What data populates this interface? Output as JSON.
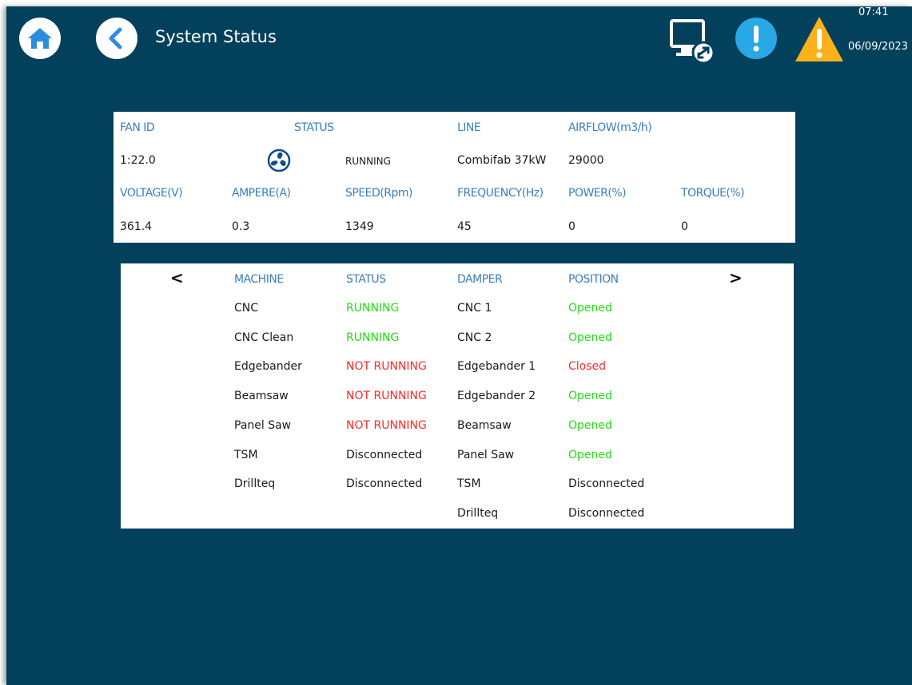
{
  "header": {
    "title": "System Status",
    "time": "07:41",
    "date": "06/09/2023",
    "icons": [
      "home-icon",
      "back-icon",
      "remote-desktop-icon",
      "info-icon",
      "warning-icon"
    ]
  },
  "fan": {
    "headers": {
      "fan_id": "FAN ID",
      "status": "STATUS",
      "line": "LINE",
      "airflow": "AIRFLOW(m3/h)",
      "voltage": "VOLTAGE(V)",
      "ampere": "AMPERE(A)",
      "speed": "SPEED(Rpm)",
      "frequency": "FREQUENCY(Hz)",
      "power": "POWER(%)",
      "torque": "TORQUE(%)"
    },
    "values": {
      "fan_id": "1:22.0",
      "status": "RUNNING",
      "line": "Combifab 37kW",
      "airflow": "29000",
      "voltage": "361.4",
      "ampere": "0.3",
      "speed": "1349",
      "frequency": "45",
      "power": "0",
      "torque": "0"
    }
  },
  "machines": {
    "nav_prev": "<",
    "nav_next": ">",
    "headers": {
      "machine": "MACHINE",
      "status": "STATUS",
      "damper": "DAMPER",
      "position": "POSITION"
    },
    "machine_rows": [
      {
        "name": "CNC",
        "status": "RUNNING",
        "state": "running"
      },
      {
        "name": "CNC Clean",
        "status": "RUNNING",
        "state": "running"
      },
      {
        "name": "Edgebander",
        "status": "NOT RUNNING",
        "state": "stopped"
      },
      {
        "name": "Beamsaw",
        "status": "NOT RUNNING",
        "state": "stopped"
      },
      {
        "name": "Panel Saw",
        "status": "NOT RUNNING",
        "state": "stopped"
      },
      {
        "name": "TSM",
        "status": "Disconnected",
        "state": "disconnected"
      },
      {
        "name": "Drillteq",
        "status": "Disconnected",
        "state": "disconnected"
      }
    ],
    "damper_rows": [
      {
        "name": "CNC 1",
        "position": "Opened",
        "state": "opened"
      },
      {
        "name": "CNC 2",
        "position": "Opened",
        "state": "opened"
      },
      {
        "name": "Edgebander 1",
        "position": "Closed",
        "state": "closed"
      },
      {
        "name": "Edgebander 2",
        "position": "Opened",
        "state": "opened"
      },
      {
        "name": "Beamsaw",
        "position": "Opened",
        "state": "opened"
      },
      {
        "name": "Panel Saw",
        "position": "Opened",
        "state": "opened"
      },
      {
        "name": "TSM",
        "position": "Disconnected",
        "state": "disconnected"
      },
      {
        "name": "Drillteq",
        "position": "Disconnected",
        "state": "disconnected"
      }
    ]
  },
  "colors": {
    "background": "#02405c",
    "header_text": "#3b7fba",
    "running": "#22e012",
    "stopped": "#ff2a2a",
    "info": "#28a9e6",
    "warning": "#fbb11a",
    "fan_icon": "#0f4c8a"
  }
}
